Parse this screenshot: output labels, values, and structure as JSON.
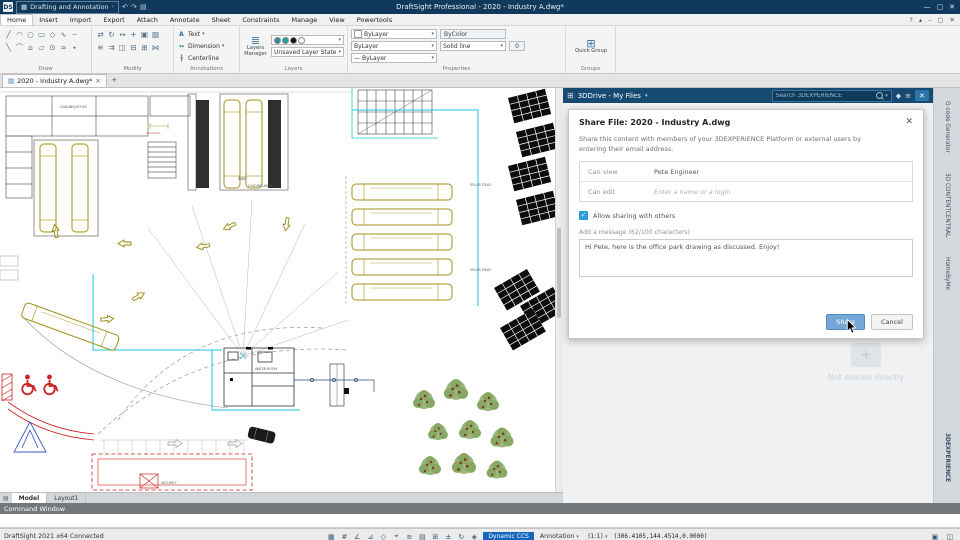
{
  "ui": {
    "caret_down": "▾"
  },
  "titlebar": {
    "logo": "DS",
    "workspace_icon": "▦",
    "workspace": "Drafting and Annotation",
    "quick_icons": [
      "↶",
      "↷",
      "▤"
    ],
    "title": "DraftSight Professional - 2020 - Industry A.dwg*",
    "minimize": "—",
    "maximize": "▢",
    "close": "✕"
  },
  "menubar": {
    "items": [
      "Home",
      "Insert",
      "Import",
      "Export",
      "Attach",
      "Annotate",
      "Sheet",
      "Constraints",
      "Manage",
      "View",
      "Powertools"
    ],
    "help": "?",
    "collapse": "▴",
    "doc_min": "–",
    "doc_restore": "▢",
    "doc_close": "✕"
  },
  "ribbon": {
    "draw": {
      "label": "Draw",
      "icons": [
        "╱",
        "◠",
        "○",
        "▭",
        "◇",
        "∿",
        "┄",
        "╲",
        "⌒",
        "⌂",
        "▱",
        "⊙",
        "≈",
        "∙"
      ]
    },
    "modify": {
      "label": "Modify",
      "icons": [
        "⇄",
        "↻",
        "↔",
        "+",
        "▣",
        "▨",
        "≋",
        "⇉",
        "◫",
        "⊟",
        "⊞",
        "⋈"
      ]
    },
    "annotations": {
      "label": "Annotations",
      "text_icon": "A",
      "text": "Text",
      "dim_icon": "↔",
      "dimension": "Dimension",
      "cl_icon": "╂",
      "centerline": "Centerline"
    },
    "layers": {
      "label": "Layers",
      "manager_icon": "≣",
      "manager": "Layers Manager",
      "swatches": [
        "#2e86ab",
        "#19a0a0",
        "#111111",
        "#ffffff"
      ],
      "state": "Unsaved Layer State"
    },
    "properties": {
      "label": "Properties",
      "color": "ByLayer",
      "bycolor": "ByColor",
      "linestyle": "ByLayer",
      "solid": "Solid line",
      "zero": "0",
      "weight_glyph": "—",
      "lineweight": "ByLayer"
    },
    "groups": {
      "label": "Groups",
      "quick_icon": "⊞",
      "quick": "Quick Group"
    }
  },
  "doctab": {
    "icon": "▤",
    "label": "2020 - Industry A.dwg*",
    "close": "✕",
    "add": "+"
  },
  "drawing": {
    "labels": {
      "loading_office": "LOADING/OFFICE",
      "loading_area": "LOADING AREA",
      "dim_400": "400",
      "solar_field_1": "SOLAR FIELD",
      "solar_field_2": "SOLAR FIELD",
      "water_room": "WATER ROOM",
      "security": "SECURITY"
    }
  },
  "panel": {
    "grid_icon": "⊞",
    "title": "3DDrive - My Files",
    "search_placeholder": "Search 3DEXPERIENCE",
    "tag_icon": "◆",
    "menu_icon": "≡",
    "close_icon": "✕",
    "plus": "+",
    "not_shared": "Not shared directly"
  },
  "dialog": {
    "title": "Share File: 2020 - Industry A.dwg",
    "close": "✕",
    "description": "Share this content with members of your 3DEXPERIENCE Platform or external users by entering their email address.",
    "can_view_label": "Can view",
    "can_view_value": "Pete Engineer",
    "can_edit_label": "Can edit",
    "can_edit_placeholder": "Enter a name or a login",
    "checkbox_glyph": "✓",
    "allow_sharing": "Allow sharing with others",
    "message_label": "Add a message (62/100 characters)",
    "message_value": "Hi Pete, here is the office park drawing as discussed. Enjoy!",
    "share": "Share",
    "cancel": "Cancel"
  },
  "side": {
    "tabs": [
      "G-code Generator",
      "3D CONTENTCENTRAL",
      "HomeByMe"
    ],
    "bottom": "3DEXPERIENCE"
  },
  "sheet_tabs": {
    "model": "Model",
    "layout": "Layout1"
  },
  "command": {
    "title": "Command Window"
  },
  "statusbar": {
    "app": "DraftSight 2021 x64 Connected",
    "icons": [
      "▦",
      "#",
      "∠",
      "⊿",
      "◇",
      "⌖",
      "≡",
      "▤",
      "⊞",
      "±",
      "↻",
      "◈"
    ],
    "dynamic_ccs": "Dynamic CCS",
    "annotation": "Annotation",
    "scale": "(1:1)",
    "coords": "(306.4105,144.4514,0.0000)",
    "right_icons": [
      "▣",
      "◫"
    ]
  }
}
